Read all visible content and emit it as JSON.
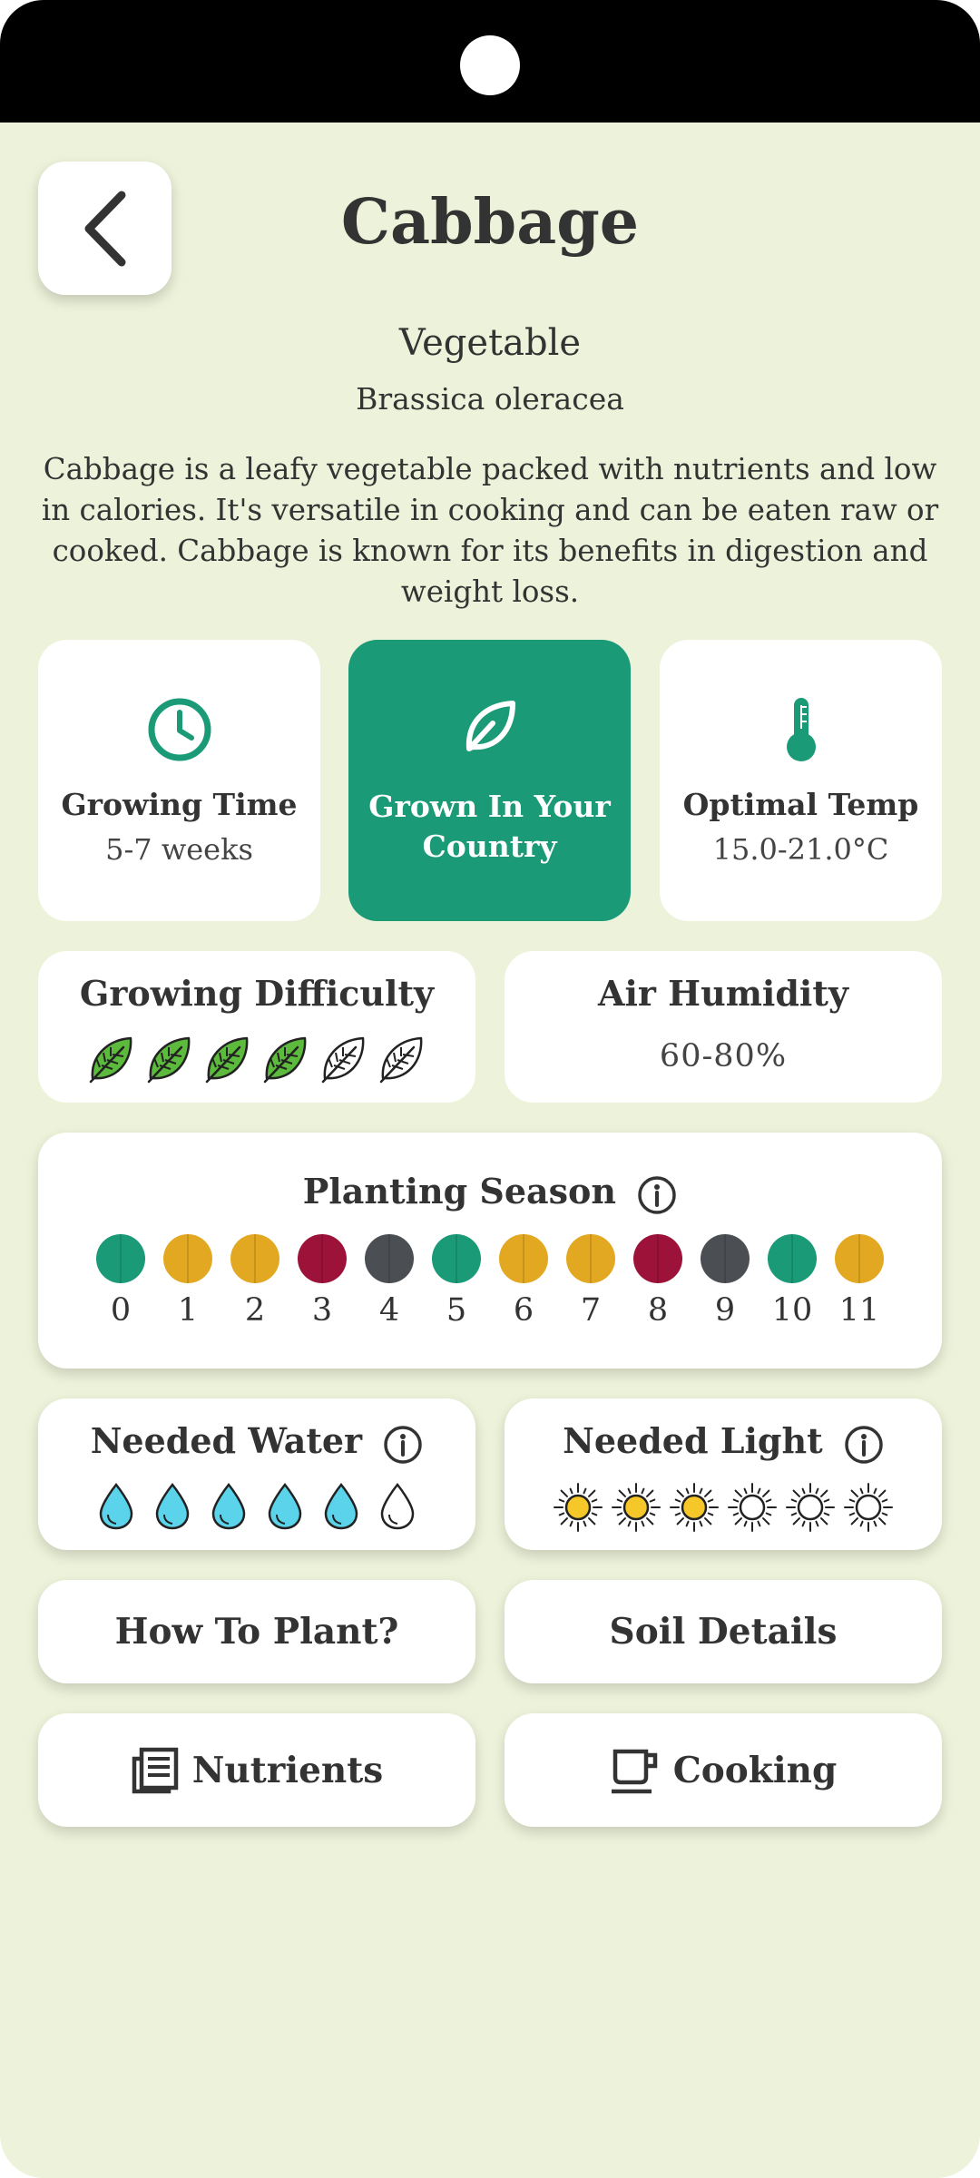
{
  "header": {
    "back_icon": "chevron-left-icon",
    "title": "Cabbage"
  },
  "plant": {
    "category": "Vegetable",
    "latin_name": "Brassica oleracea",
    "description": "Cabbage is a leafy vegetable packed with nutrients and low in calories. It's versatile in cooking and can be eaten raw or cooked. Cabbage is known for its benefits in digestion and weight loss."
  },
  "stats": {
    "growing_time": {
      "icon": "clock-icon",
      "title": "Growing Time",
      "value": "5-7 weeks"
    },
    "grown_in_country": {
      "icon": "leaf-icon",
      "title": "Grown In Your Country"
    },
    "optimal_temp": {
      "icon": "thermometer-icon",
      "title": "Optimal Temp",
      "value": "15.0-21.0°C"
    }
  },
  "difficulty": {
    "title": "Growing Difficulty",
    "level": 4,
    "max": 6,
    "icon": "leaf-icon"
  },
  "humidity": {
    "title": "Air Humidity",
    "value": "60-80%"
  },
  "planting_season": {
    "title": "Planting Season",
    "info_icon": "info-icon",
    "months": [
      {
        "label": "0",
        "color": "#1a9a76"
      },
      {
        "label": "1",
        "color": "#e3a821"
      },
      {
        "label": "2",
        "color": "#e3a821"
      },
      {
        "label": "3",
        "color": "#9c1238"
      },
      {
        "label": "4",
        "color": "#4b4f53"
      },
      {
        "label": "5",
        "color": "#1a9a76"
      },
      {
        "label": "6",
        "color": "#e3a821"
      },
      {
        "label": "7",
        "color": "#e3a821"
      },
      {
        "label": "8",
        "color": "#9c1238"
      },
      {
        "label": "9",
        "color": "#4b4f53"
      },
      {
        "label": "10",
        "color": "#1a9a76"
      },
      {
        "label": "11",
        "color": "#e3a821"
      }
    ]
  },
  "water": {
    "title": "Needed Water",
    "level": 5,
    "max": 6,
    "icon": "water-drop-icon"
  },
  "light": {
    "title": "Needed Light",
    "level": 3,
    "max": 6,
    "icon": "sun-icon"
  },
  "actions": {
    "how_to_plant": "How To Plant?",
    "soil_details": "Soil Details",
    "nutrients": {
      "label": "Nutrients",
      "icon": "newspaper-icon"
    },
    "cooking": {
      "label": "Cooking",
      "icon": "cup-icon"
    }
  },
  "colors": {
    "background": "#edf3da",
    "accent_green": "#1a9a76",
    "leaf_green": "#5cba3c",
    "water_blue": "#5bd3ea",
    "sun_yellow": "#f6c728"
  }
}
